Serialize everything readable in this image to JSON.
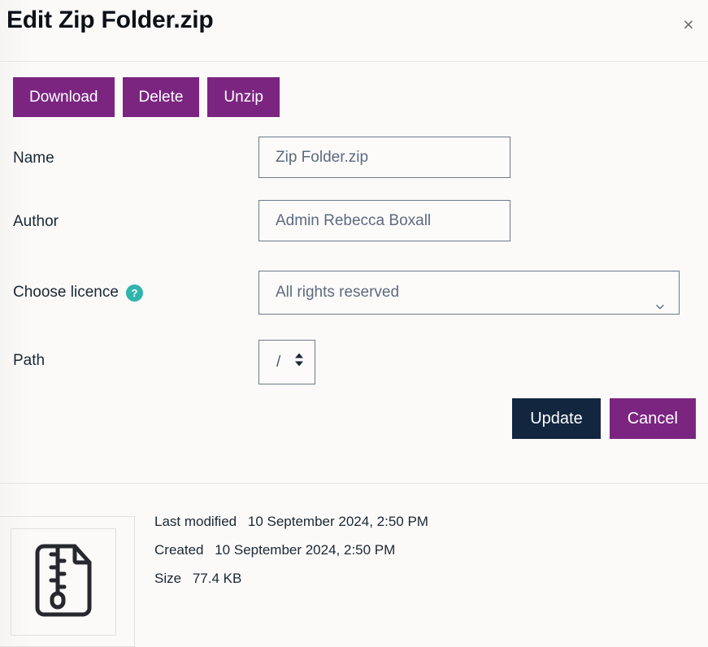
{
  "dialog": {
    "title": "Edit Zip Folder.zip",
    "close_label": "×",
    "close_icon": "close-icon"
  },
  "actions": {
    "download_label": "Download",
    "delete_label": "Delete",
    "unzip_label": "Unzip"
  },
  "form": {
    "name": {
      "label": "Name",
      "value": "Zip Folder.zip",
      "placeholder": "Zip Folder.zip"
    },
    "author": {
      "label": "Author",
      "value": "Admin Rebecca Boxall",
      "placeholder": "Admin Rebecca Boxall"
    },
    "licence": {
      "label": "Choose licence",
      "help_icon": "?",
      "value": "All rights reserved",
      "chevron_icon": "chevron-down-icon"
    },
    "path": {
      "label": "Path",
      "value": "/",
      "spinner_icon": "up-down-arrows-icon"
    }
  },
  "footer_actions": {
    "update_label": "Update",
    "cancel_label": "Cancel"
  },
  "meta": {
    "thumbnail_icon": "zip-file-icon",
    "rows": [
      {
        "label": "Last modified",
        "value": "10 September 2024, 2:50 PM"
      },
      {
        "label": "Created",
        "value": "10 September 2024, 2:50 PM"
      },
      {
        "label": "Size",
        "value": "77.4 KB"
      }
    ]
  },
  "colors": {
    "purple": "#7b2581",
    "dark_navy": "#12263f",
    "teal": "#30b4ac",
    "field_border": "#6d7a8c",
    "background": "#fbfaf9"
  }
}
